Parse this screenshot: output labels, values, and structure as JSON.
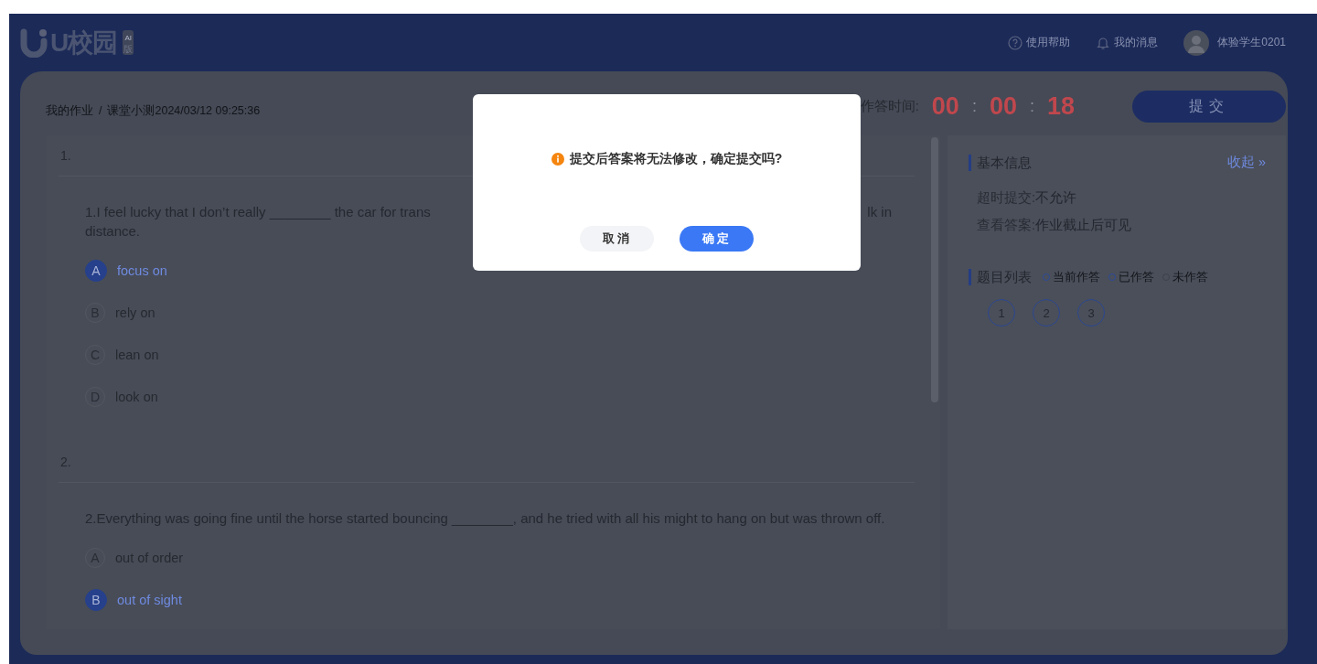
{
  "header": {
    "logo": {
      "text": "U校园",
      "badge": [
        "AI",
        "版"
      ]
    },
    "links": [
      {
        "kind": "help",
        "label": "使用帮助"
      },
      {
        "kind": "messages",
        "label": "我的消息"
      }
    ],
    "user": {
      "name": "体验学生0201"
    }
  },
  "breadcrumb": {
    "items": [
      "我的作业",
      "课堂小测2024/03/12 09:25:36"
    ],
    "separator": "/"
  },
  "timer": {
    "label": "作答时间:",
    "parts": [
      "00",
      "00",
      "18"
    ],
    "separator": ":"
  },
  "submit_button": "提交",
  "questions": [
    {
      "number": "1.",
      "stem_lines": [
        [
          "1.I feel lucky that I don’t really ________ the car for trans",
          "lk in"
        ],
        [
          "distance."
        ]
      ],
      "options": [
        {
          "letter": "A",
          "text": "focus on",
          "selected": true
        },
        {
          "letter": "B",
          "text": "rely on",
          "selected": false
        },
        {
          "letter": "C",
          "text": "lean on",
          "selected": false
        },
        {
          "letter": "D",
          "text": "look on",
          "selected": false
        }
      ]
    },
    {
      "number": "2.",
      "stem_lines": [
        [
          "2.Everything was going fine until the horse started bouncing ________, and he tried with all his might to hang on but was thrown off."
        ]
      ],
      "options": [
        {
          "letter": "A",
          "text": "out of order",
          "selected": false
        },
        {
          "letter": "B",
          "text": "out of sight",
          "selected": true
        }
      ]
    }
  ],
  "sidebar": {
    "info_title": "基本信息",
    "collapse_link": "收起 »",
    "info_rows": [
      {
        "label": "超时提交:",
        "value": "不允许"
      },
      {
        "label": "查看答案:",
        "value": "作业截止后可见"
      }
    ],
    "list_title": "题目列表",
    "legend": [
      {
        "label": "当前作答",
        "color": "#2c4a98"
      },
      {
        "label": "已作答",
        "color": "#2c4a98"
      },
      {
        "label": "未作答",
        "color": "#3c414b"
      }
    ],
    "question_numbers": [
      "1",
      "2",
      "3"
    ]
  },
  "dialog": {
    "message": "提交后答案将无法修改，确定提交吗?",
    "buttons": [
      {
        "label": "取消",
        "kind": "secondary"
      },
      {
        "label": "确定",
        "kind": "primary"
      }
    ]
  }
}
